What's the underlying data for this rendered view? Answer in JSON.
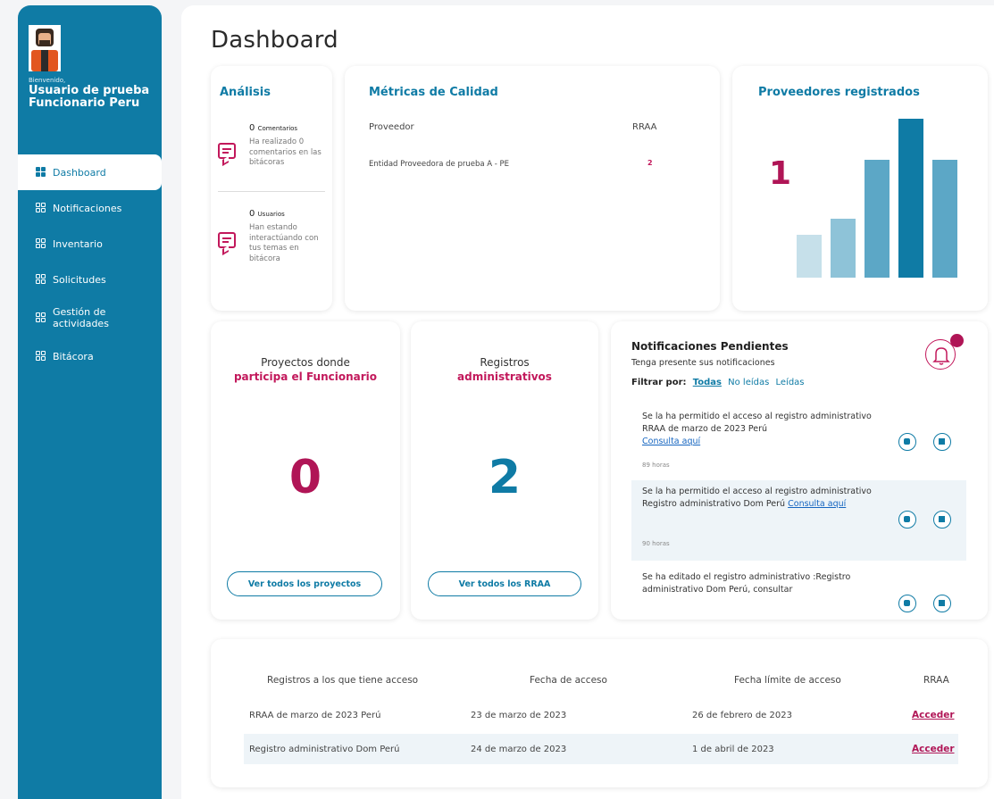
{
  "sidebar": {
    "welcome": "Bienvenido,",
    "username": "Usuario de prueba Funcionario Peru",
    "items": [
      {
        "label": "Dashboard",
        "active": true
      },
      {
        "label": "Notificaciones"
      },
      {
        "label": "Inventario"
      },
      {
        "label": "Solicitudes"
      },
      {
        "label": "Gestión de actividades"
      },
      {
        "label": "Bitácora"
      }
    ]
  },
  "page": {
    "title": "Dashboard"
  },
  "analisis": {
    "title": "Análisis",
    "comentarios": {
      "count": "0",
      "unit": "Comentarios",
      "desc": "Ha realizado 0 comentarios en las bitácoras"
    },
    "usuarios": {
      "count": "0",
      "unit": "Usuarios",
      "desc": "Han estando interactúando con tus temas en bitácora"
    }
  },
  "metricas": {
    "title": "Métricas de Calidad",
    "col_proveedor": "Proveedor",
    "col_rraa": "RRAA",
    "rows": [
      {
        "proveedor": "Entidad Proveedora de prueba A - PE",
        "rraa": "2"
      }
    ]
  },
  "proveedores": {
    "title": "Proveedores registrados",
    "count": "1",
    "bars": [
      {
        "level": 0.27,
        "color": "#c6e0ea"
      },
      {
        "level": 0.37,
        "color": "#8ec3d8"
      },
      {
        "level": 0.74,
        "color": "#5ca7c6"
      },
      {
        "level": 1.0,
        "color": "#0f7ba5"
      },
      {
        "level": 0.74,
        "color": "#5ca7c6"
      }
    ]
  },
  "proyectos": {
    "label_line1": "Proyectos donde",
    "label_line2": "participa el Funcionario",
    "count": "0",
    "button": "Ver todos los proyectos"
  },
  "registros": {
    "label_line1": "Registros",
    "label_line2": "administrativos",
    "count": "2",
    "button": "Ver todos los RRAA"
  },
  "notificaciones": {
    "title": "Notificaciones Pendientes",
    "subtitle": "Tenga presente sus notificaciones",
    "filter_label": "Filtrar por:",
    "filters": [
      "Todas",
      "No leídas",
      "Leídas"
    ],
    "items": [
      {
        "text": "Se la ha permitido el acceso al registro administrativo RRAA de marzo de 2023 Perú",
        "link": "Consulta aquí",
        "time": "89 horas"
      },
      {
        "text": "Se la ha permitido el acceso al registro administrativo Registro administrativo Dom Perú",
        "link": "Consulta aquí",
        "time": "90 horas"
      },
      {
        "text": "Se ha editado el registro administrativo :Registro administrativo Dom Perú, consultar",
        "link": "",
        "time": ""
      }
    ]
  },
  "tabla": {
    "headers": [
      "Registros a los que tiene acceso",
      "Fecha de acceso",
      "Fecha límite de acceso",
      "RRAA"
    ],
    "rows": [
      [
        "RRAA de marzo de 2023 Perú",
        "23 de marzo de 2023",
        "26 de febrero de 2023",
        "Acceder"
      ],
      [
        "Registro administrativo Dom Perú",
        "24 de marzo de 2023",
        "1 de abril de 2023",
        "Acceder"
      ]
    ]
  },
  "colors": {
    "primary": "#0f7ba5",
    "accent": "#c2185b",
    "accent_dark": "#b01556"
  }
}
